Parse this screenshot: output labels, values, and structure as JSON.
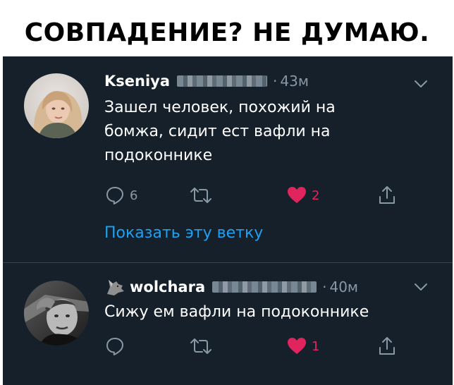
{
  "headline": "СОВПАДЕНИЕ? НЕ ДУМАЮ.",
  "colors": {
    "background": "#15202b",
    "text": "#ffffff",
    "muted": "#8899a6",
    "link": "#1da1f2",
    "like": "#e0245e",
    "divider": "#38444d"
  },
  "tweets": [
    {
      "name": "Kseniya",
      "separator": "·",
      "time": "43м",
      "text": "Зашел человек, похожий на бомжа, сидит ест вафли на подоконнике",
      "replies": "6",
      "retweets": "",
      "likes": "2",
      "liked": true,
      "show_thread": "Показать эту ветку",
      "icons": [
        "avatar",
        "chevron-down-icon",
        "reply-icon",
        "retweet-icon",
        "heart-icon",
        "share-icon"
      ]
    },
    {
      "name": "wolchara",
      "separator": "·",
      "time": "40м",
      "text": "Сижу ем вафли на подоконнике",
      "replies": "",
      "retweets": "",
      "likes": "1",
      "liked": true,
      "icons": [
        "wolf-badge-icon",
        "avatar",
        "chevron-down-icon",
        "reply-icon",
        "retweet-icon",
        "heart-icon",
        "share-icon"
      ]
    }
  ]
}
